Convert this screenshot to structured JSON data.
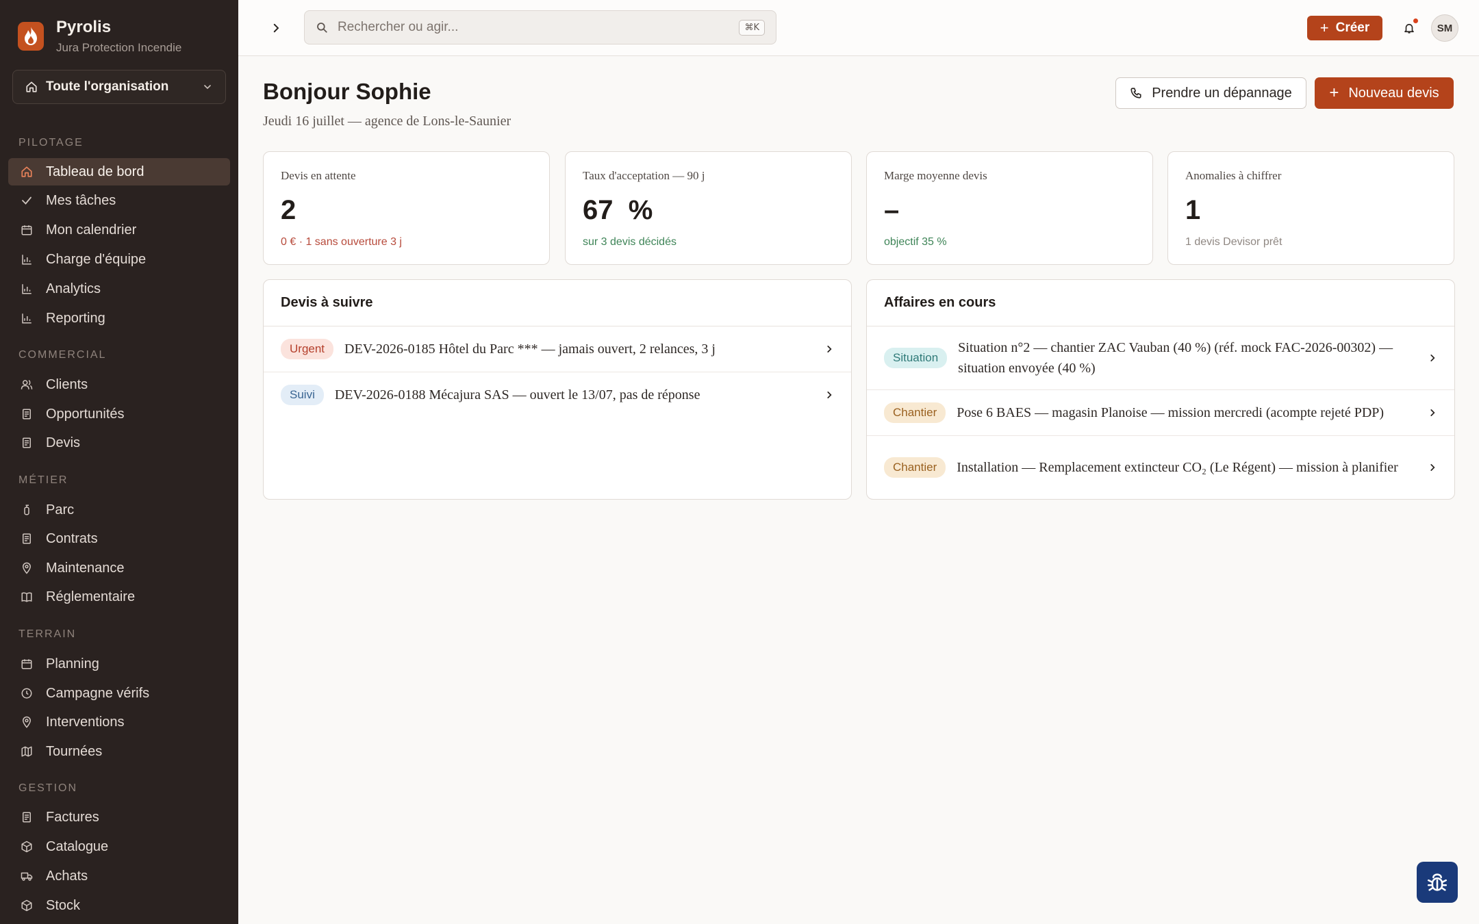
{
  "brand": {
    "name": "Pyrolis",
    "subtitle": "Jura Protection Incendie"
  },
  "org_select": {
    "label": "Toute l'organisation"
  },
  "nav": {
    "sections": [
      {
        "title": "PILOTAGE",
        "items": [
          {
            "label": "Tableau de bord",
            "icon": "home-icon",
            "active": true
          },
          {
            "label": "Mes tâches",
            "icon": "check-icon"
          },
          {
            "label": "Mon calendrier",
            "icon": "calendar-icon"
          },
          {
            "label": "Charge d'équipe",
            "icon": "bar-chart-icon"
          },
          {
            "label": "Analytics",
            "icon": "bar-chart-icon"
          },
          {
            "label": "Reporting",
            "icon": "bar-chart-icon"
          }
        ]
      },
      {
        "title": "COMMERCIAL",
        "items": [
          {
            "label": "Clients",
            "icon": "users-icon"
          },
          {
            "label": "Opportunités",
            "icon": "document-icon"
          },
          {
            "label": "Devis",
            "icon": "document-icon"
          }
        ]
      },
      {
        "title": "MÉTIER",
        "items": [
          {
            "label": "Parc",
            "icon": "extinguisher-icon"
          },
          {
            "label": "Contrats",
            "icon": "document-icon"
          },
          {
            "label": "Maintenance",
            "icon": "location-pin-icon"
          },
          {
            "label": "Réglementaire",
            "icon": "book-icon"
          }
        ]
      },
      {
        "title": "TERRAIN",
        "items": [
          {
            "label": "Planning",
            "icon": "calendar-icon"
          },
          {
            "label": "Campagne vérifs",
            "icon": "clock-icon"
          },
          {
            "label": "Interventions",
            "icon": "location-pin-icon"
          },
          {
            "label": "Tournées",
            "icon": "map-icon"
          }
        ]
      },
      {
        "title": "GESTION",
        "items": [
          {
            "label": "Factures",
            "icon": "document-icon"
          },
          {
            "label": "Catalogue",
            "icon": "box-icon"
          },
          {
            "label": "Achats",
            "icon": "truck-icon"
          },
          {
            "label": "Stock",
            "icon": "box-icon"
          }
        ]
      }
    ]
  },
  "topbar": {
    "search_placeholder": "Rechercher ou agir...",
    "search_shortcut": "⌘K",
    "create_label": "Créer",
    "avatar_initials": "SM"
  },
  "header": {
    "greeting": "Bonjour Sophie",
    "subline": "Jeudi 16 juillet — agence de Lons-le-Saunier",
    "depannage_label": "Prendre un dépannage",
    "nouveau_devis_label": "Nouveau devis"
  },
  "kpis": [
    {
      "label": "Devis en attente",
      "value": "2",
      "note": "0 € · 1 sans ouverture 3 j",
      "tone": "red"
    },
    {
      "label": "Taux d'acceptation — 90 j",
      "value": "67  %",
      "note": "sur 3 devis décidés",
      "tone": "green"
    },
    {
      "label": "Marge moyenne devis",
      "value": "–",
      "note": "objectif 35 %",
      "tone": "green"
    },
    {
      "label": "Anomalies à chiffrer",
      "value": "1",
      "note": "1 devis Devisor prêt",
      "tone": "grey"
    }
  ],
  "devis_panel": {
    "title": "Devis à suivre",
    "rows": [
      {
        "badge": "Urgent",
        "text": "DEV-2026-0185 Hôtel du Parc *** — jamais ouvert, 2 relances, 3 j"
      },
      {
        "badge": "Suivi",
        "text": "DEV-2026-0188 Mécajura SAS — ouvert le 13/07, pas de réponse"
      }
    ]
  },
  "affaires_panel": {
    "title": "Affaires en cours",
    "rows": [
      {
        "badge": "Situation",
        "text": "Situation n°2 — chantier ZAC Vauban (40 %) (réf. mock FAC-2026-00302) — situation envoyée (40 %)"
      },
      {
        "badge": "Chantier",
        "text": "Pose 6 BAES — magasin Planoise — mission mercredi (acompte rejeté PDP)"
      },
      {
        "badge": "Chantier",
        "text": "Installation — Remplacement extincteur CO₂ (Le Régent) — mission à planifier"
      }
    ]
  },
  "colors": {
    "accent": "#b4431b",
    "sidebar_bg": "#2a2220",
    "fab_bg": "#1a3a7a"
  },
  "fab": {
    "icon": "bug-icon"
  }
}
